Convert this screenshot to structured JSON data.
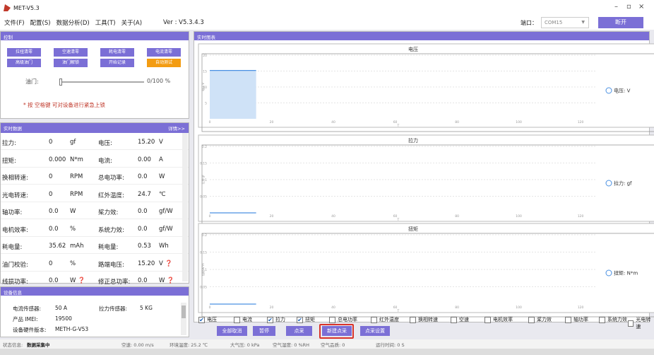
{
  "app": {
    "title": "MET-V5.3"
  },
  "window_controls": {
    "minimize": "–",
    "restore": "▫",
    "close": "×"
  },
  "menu": {
    "items": [
      "文件(F)",
      "配置(S)",
      "数据分析(D)",
      "工具(T)",
      "关于(A)"
    ],
    "version": "Ver : V5.3.4.3"
  },
  "port": {
    "label": "端口：",
    "value": "COM15",
    "chevron": "▼",
    "open_label": "断开"
  },
  "control": {
    "header": "控制",
    "buttons": [
      "拉扭清零",
      "空速清零",
      "耗电清零",
      "电流清零",
      "高级油门",
      "油门解锁",
      "开始记录",
      "自动测试"
    ],
    "throttle_label": "油门:",
    "throttle_value": "0/100 %",
    "throttle_fraction": 0,
    "hint": "* 按 空格键 可对设备进行紧急上锁"
  },
  "realtime": {
    "header": "实时数据",
    "details": "详情>>",
    "rows": [
      {
        "l1": "拉力:",
        "v1": "0",
        "u1": "gf",
        "l2": "电压:",
        "v2": "15.20",
        "u2": "V"
      },
      {
        "l1": "扭矩:",
        "v1": "0.000",
        "u1": "N*m",
        "l2": "电流:",
        "v2": "0.00",
        "u2": "A"
      },
      {
        "l1": "换相转速:",
        "v1": "0",
        "u1": "RPM",
        "l2": "总电功率:",
        "v2": "0.0",
        "u2": "W"
      },
      {
        "l1": "光电转速:",
        "v1": "0",
        "u1": "RPM",
        "l2": "红外温度:",
        "v2": "24.7",
        "u2": "℃"
      },
      {
        "l1": "轴功率:",
        "v1": "0.0",
        "u1": "W",
        "l2": "桨力效:",
        "v2": "0.0",
        "u2": "gf/W"
      },
      {
        "l1": "电机效率:",
        "v1": "0.0",
        "u1": "%",
        "l2": "系统力效:",
        "v2": "0.0",
        "u2": "gf/W"
      },
      {
        "l1": "耗电量:",
        "v1": "35.62",
        "u1": "mAh",
        "l2": "耗电量:",
        "v2": "0.53",
        "u2": "Wh"
      },
      {
        "l1": "油门校验:",
        "v1": "0",
        "u1": "%",
        "l2": "路端电压:",
        "v2": "15.20",
        "u2": "V ❓"
      },
      {
        "l1": "线损功率:",
        "v1": "0.0",
        "u1": "W ❓",
        "l2": "修正总功率:",
        "v2": "0.0",
        "u2": "W ❓"
      }
    ]
  },
  "device": {
    "header": "设备信息",
    "current_sensor_label": "电流传感器:",
    "current_sensor_value": "50 A",
    "pull_sensor_label": "拉力传感器:",
    "pull_sensor_value": "5 KG",
    "imei_label": "产品 IMEI:",
    "imei_value": "19500",
    "hw_label": "设备硬件版本:",
    "hw_value": "METH-G-V53"
  },
  "realtime_chart": {
    "header": "实时图表"
  },
  "chart_data": [
    {
      "type": "area",
      "title": "电压",
      "xlabel": "T",
      "ylabel": "电压 V",
      "legend": "电压: V",
      "xlim": [
        0,
        125
      ],
      "ylim": [
        0,
        20
      ],
      "x_ticks": [
        0,
        20,
        40,
        60,
        80,
        100,
        120
      ],
      "y_ticks": [
        5,
        10,
        15,
        20
      ],
      "x": [
        0,
        15
      ],
      "y": [
        15.2,
        15.2
      ]
    },
    {
      "type": "line",
      "title": "拉力",
      "xlabel": "T",
      "ylabel": "拉力 gf",
      "legend": "拉力: gf",
      "xlim": [
        0,
        125
      ],
      "ylim": [
        0,
        0.2
      ],
      "x_ticks": [
        0,
        20,
        40,
        60,
        80,
        100,
        120
      ],
      "y_ticks": [
        0.05,
        0.1,
        0.15,
        0.2
      ],
      "x": [
        0,
        15
      ],
      "y": [
        0,
        0
      ]
    },
    {
      "type": "line",
      "title": "扭矩",
      "xlabel": "T",
      "ylabel": "扭矩 N*m",
      "legend": "扭矩: N*m",
      "xlim": [
        0,
        125
      ],
      "ylim": [
        0,
        0.2
      ],
      "x_ticks": [
        0,
        20,
        40,
        60,
        80,
        100,
        120
      ],
      "y_ticks": [
        0.05,
        0.1,
        0.15,
        0.2
      ],
      "x": [
        0,
        15
      ],
      "y": [
        0,
        0
      ]
    }
  ],
  "checkboxes": [
    {
      "label": "电压",
      "checked": true
    },
    {
      "label": "电流",
      "checked": false
    },
    {
      "label": "拉力",
      "checked": true
    },
    {
      "label": "扭矩",
      "checked": true
    },
    {
      "label": "总电功率",
      "checked": false
    },
    {
      "label": "红外温度",
      "checked": false
    },
    {
      "label": "换相转速",
      "checked": false
    },
    {
      "label": "空速",
      "checked": false
    },
    {
      "label": "电机效率",
      "checked": false
    },
    {
      "label": "桨力效",
      "checked": false
    },
    {
      "label": "轴功率",
      "checked": false
    },
    {
      "label": "系统力效",
      "checked": false
    },
    {
      "label": "光电转速",
      "checked": false
    }
  ],
  "actions": [
    "全部取消",
    "暂停",
    "点采",
    "新建点采",
    "点采设置"
  ],
  "status": {
    "state_label": "状态信息:",
    "state_value": "数据采集中",
    "airspeed": "空速: 0.00 m/s",
    "env_temp": "环境温度: 25.2 ℃",
    "pressure": "大气压: 0 kPa",
    "humidity": "空气湿度: 0 %RH",
    "air_quality": "空气品质: 0",
    "run_time": "运行时间: 0 S"
  }
}
